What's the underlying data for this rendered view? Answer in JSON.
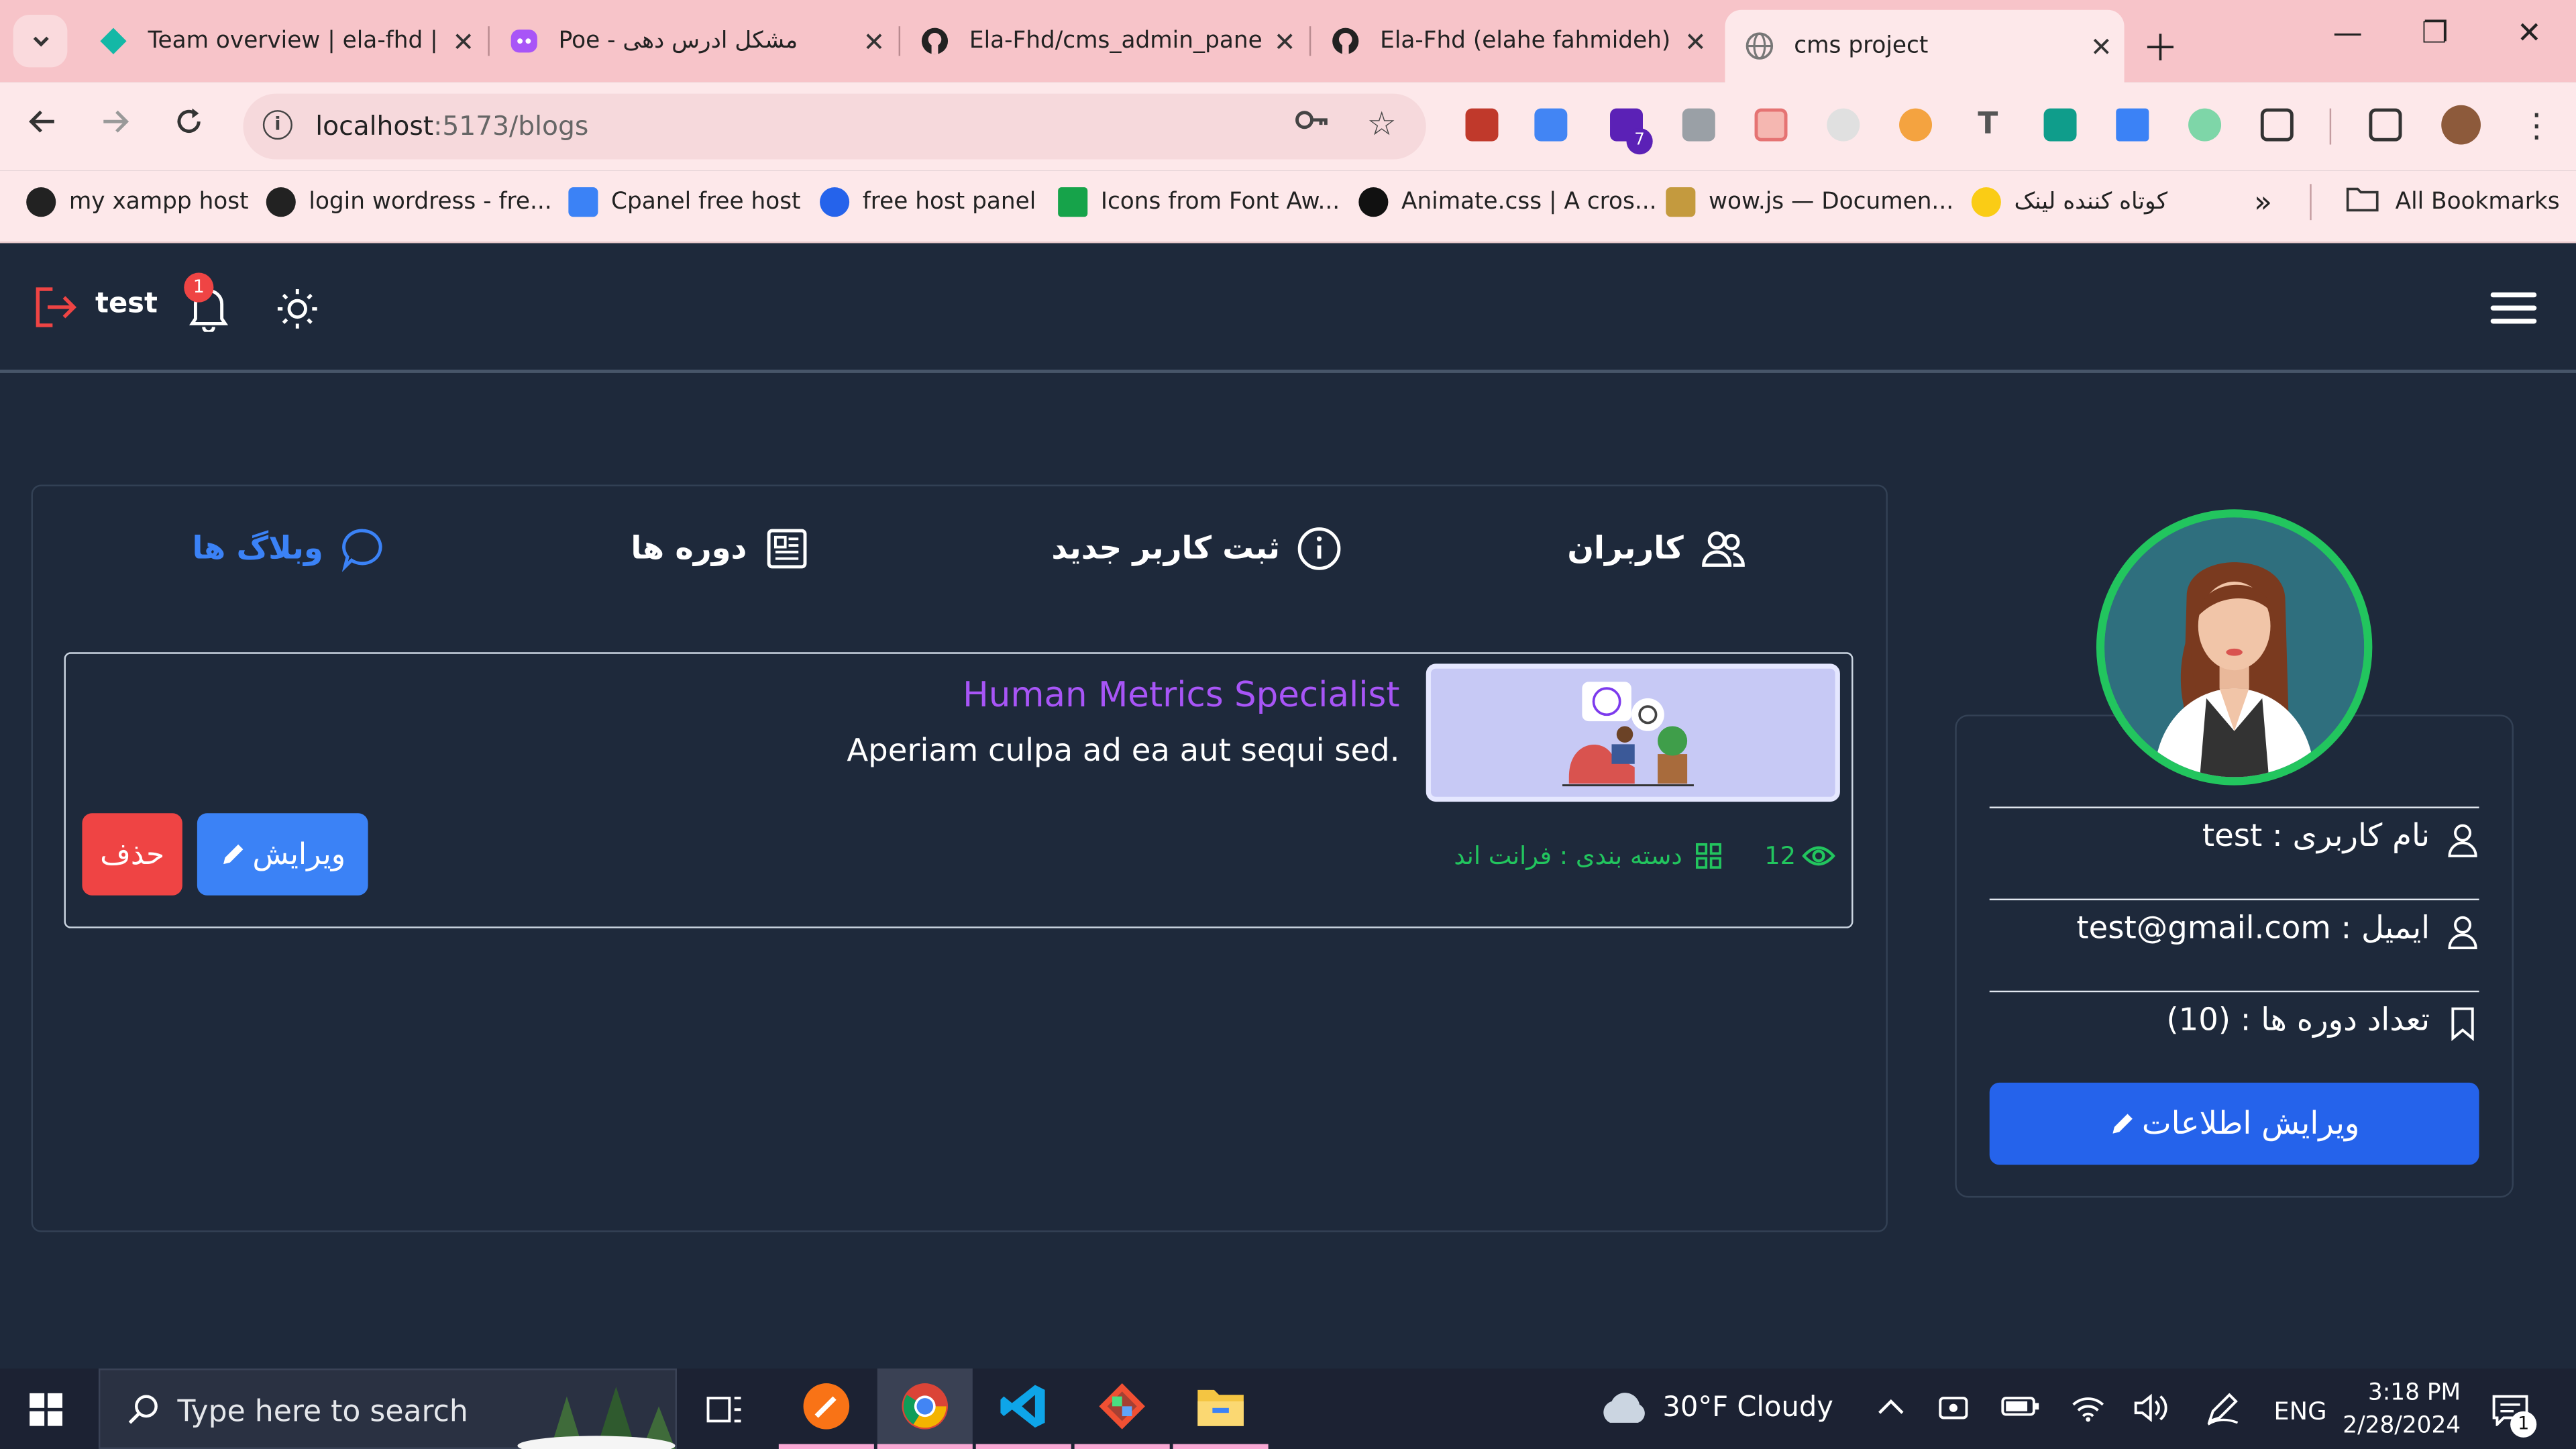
{
  "browser": {
    "tabs": [
      {
        "title": "Team overview | ela-fhd |",
        "icon": "netlify-icon"
      },
      {
        "title": "Poe - مشکل ادرس دهی",
        "icon": "poe-icon"
      },
      {
        "title": "Ela-Fhd/cms_admin_panel",
        "icon": "github-icon"
      },
      {
        "title": "Ela-Fhd (elahe fahmideh)",
        "icon": "github-icon"
      },
      {
        "title": "cms project",
        "icon": "globe-icon"
      }
    ],
    "url_host": "localhost",
    "url_path": ":5173/blogs",
    "extension_badge": "7",
    "bookmarks": [
      "my xampp host",
      "login wordress - fre...",
      "Cpanel free host",
      "free host panel",
      "Icons from Font Aw...",
      "Animate.css | A cros...",
      "wow.js — Documen...",
      "کوتاه کننده لینک"
    ],
    "all_bookmarks": "All Bookmarks"
  },
  "app": {
    "username": "test",
    "notification_count": "1",
    "tabs": [
      {
        "label": "کاربران",
        "icon": "users-icon",
        "active": false
      },
      {
        "label": "ثبت کاربر جدید",
        "icon": "info-circle-icon",
        "active": false
      },
      {
        "label": "دوره ها",
        "icon": "newspaper-icon",
        "active": false
      },
      {
        "label": "وبلاگ ها",
        "icon": "chat-bubble-icon",
        "active": true
      }
    ],
    "blog": {
      "title": "Human Metrics Specialist",
      "description": ".Aperiam culpa ad ea aut sequi sed",
      "views": "12",
      "category": "دسته بندی : فرانت اند",
      "edit_label": "ویرایش",
      "delete_label": "حذف"
    },
    "profile": {
      "username_row": "نام کاربری : test",
      "email_row": "ایمیل : test@gmail.com",
      "courses_row": "تعداد دوره ها : (10)",
      "edit_info_label": "ویرایش اطلاعات"
    }
  },
  "taskbar": {
    "search_placeholder": "Type here to search",
    "weather": "30°F  Cloudy",
    "language": "ENG",
    "time": "3:18 PM",
    "date": "2/28/2024",
    "notification_count": "1"
  },
  "colors": {
    "app_bg": "#1e293b",
    "accent_blue": "#3b82f6",
    "danger": "#ef4444",
    "success": "#22c55e",
    "blog_title": "#a855f7",
    "chrome_tabbar": "#f7c4c9"
  }
}
